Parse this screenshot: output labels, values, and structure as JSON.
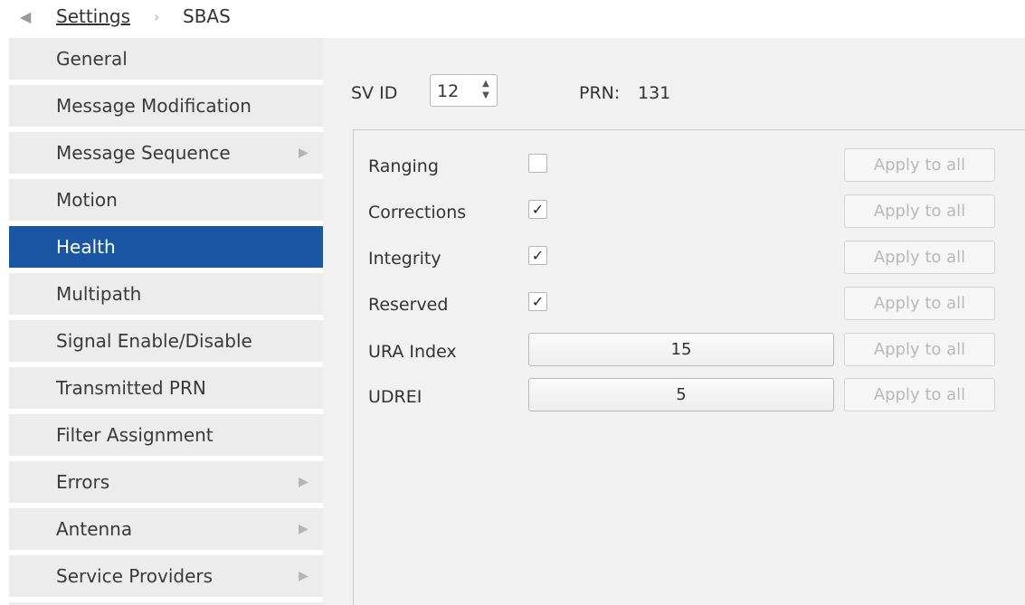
{
  "breadcrumb": {
    "back_icon": "◀",
    "root": "Settings",
    "separator_icon": "›",
    "current": "SBAS"
  },
  "sidebar": {
    "items": [
      {
        "label": "General"
      },
      {
        "label": "Message Modification"
      },
      {
        "label": "Message Sequence",
        "has_submenu": true
      },
      {
        "label": "Motion"
      },
      {
        "label": "Health",
        "selected": true
      },
      {
        "label": "Multipath"
      },
      {
        "label": "Signal Enable/Disable"
      },
      {
        "label": "Transmitted PRN"
      },
      {
        "label": "Filter Assignment"
      },
      {
        "label": "Errors",
        "has_submenu": true
      },
      {
        "label": "Antenna",
        "has_submenu": true
      },
      {
        "label": "Service Providers",
        "has_submenu": true
      }
    ],
    "submenu_icon": "▶"
  },
  "health": {
    "svid_label": "SV ID",
    "svid_value": "12",
    "prn_label": "PRN:",
    "prn_value": "131",
    "rows": [
      {
        "label": "Ranging",
        "checked": false
      },
      {
        "label": "Corrections",
        "checked": true
      },
      {
        "label": "Integrity",
        "checked": true
      },
      {
        "label": "Reserved",
        "checked": true
      },
      {
        "label": "URA Index",
        "value": "15"
      },
      {
        "label": "UDREI",
        "value": "5"
      }
    ],
    "apply_label": "Apply to all",
    "check_mark": "✓"
  },
  "colors": {
    "selected_bg": "#1a56a1",
    "sidebar_bg": "#ececec",
    "panel_bg": "#f1f1f1"
  }
}
